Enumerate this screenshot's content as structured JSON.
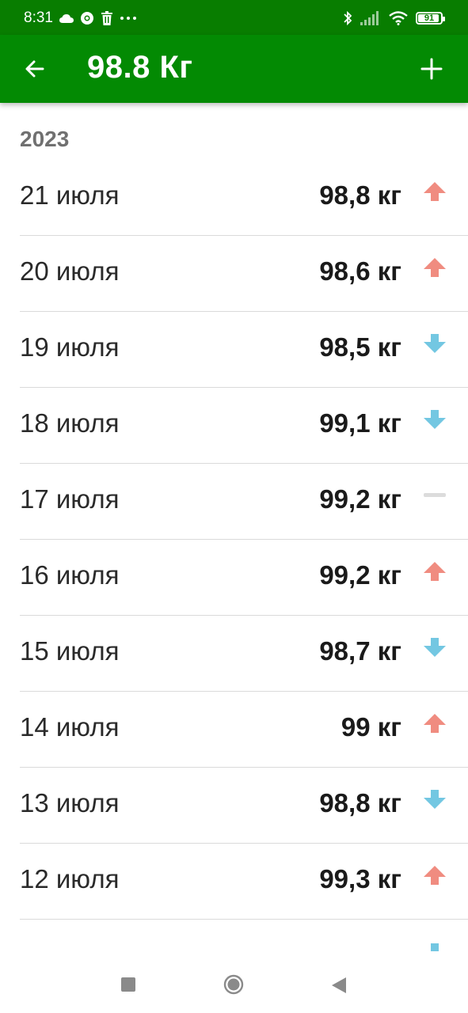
{
  "status_bar": {
    "time": "8:31",
    "battery": "91"
  },
  "app_bar": {
    "title": "98.8 Кг"
  },
  "colors": {
    "app_bar": "#038a03",
    "status_bar": "#087d00",
    "trend_up": "#f08c80",
    "trend_down": "#73c7e2",
    "trend_flat": "#dcdcdc"
  },
  "icons": {
    "back": "arrow-left-icon",
    "add": "plus-icon",
    "up": "arrow-up-icon",
    "down": "arrow-down-icon",
    "flat": "dash-icon"
  },
  "list": {
    "year": "2023",
    "entries": [
      {
        "date": "21 июля",
        "weight": "98,8 кг",
        "trend": "up"
      },
      {
        "date": "20 июля",
        "weight": "98,6 кг",
        "trend": "up"
      },
      {
        "date": "19 июля",
        "weight": "98,5 кг",
        "trend": "down"
      },
      {
        "date": "18 июля",
        "weight": "99,1 кг",
        "trend": "down"
      },
      {
        "date": "17 июля",
        "weight": "99,2 кг",
        "trend": "flat"
      },
      {
        "date": "16 июля",
        "weight": "99,2 кг",
        "trend": "up"
      },
      {
        "date": "15 июля",
        "weight": "98,7 кг",
        "trend": "down"
      },
      {
        "date": "14 июля",
        "weight": "99 кг",
        "trend": "up"
      },
      {
        "date": "13 июля",
        "weight": "98,8 кг",
        "trend": "down"
      },
      {
        "date": "12 июля",
        "weight": "99,3 кг",
        "trend": "up"
      }
    ],
    "partial_trend": "down"
  }
}
